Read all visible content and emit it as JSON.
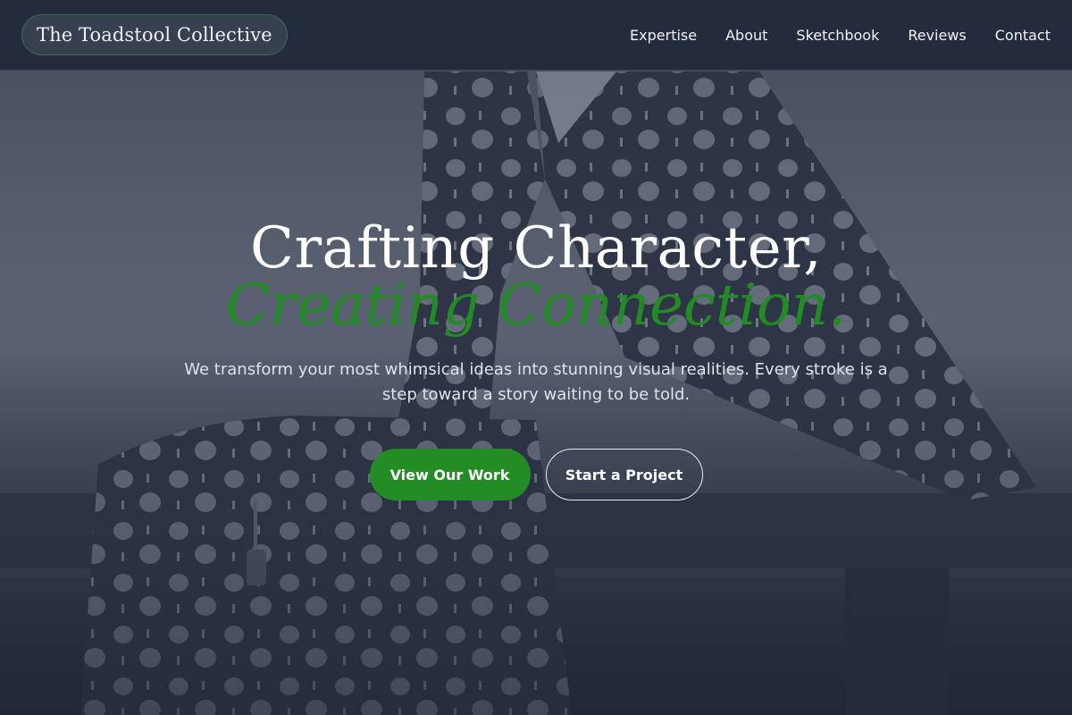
{
  "brand": {
    "name": "The Toadstool Collective"
  },
  "nav": {
    "items": [
      {
        "label": "Expertise"
      },
      {
        "label": "About"
      },
      {
        "label": "Sketchbook"
      },
      {
        "label": "Reviews"
      },
      {
        "label": "Contact"
      }
    ]
  },
  "hero": {
    "headline_line1": "Crafting Character,",
    "headline_line2": "Creating Connection.",
    "subtitle": "We transform your most whimsical ideas into stunning visual realities. Every stroke is a step toward a story waiting to be told.",
    "primary_cta": "View Our Work",
    "secondary_cta": "Start a Project",
    "background_image": "illustrated-figure-in-polka-dot-robe-seated-on-bench"
  },
  "colors": {
    "accent": "#238a26",
    "nav_bg": "#232c3d",
    "text": "#ffffff"
  }
}
